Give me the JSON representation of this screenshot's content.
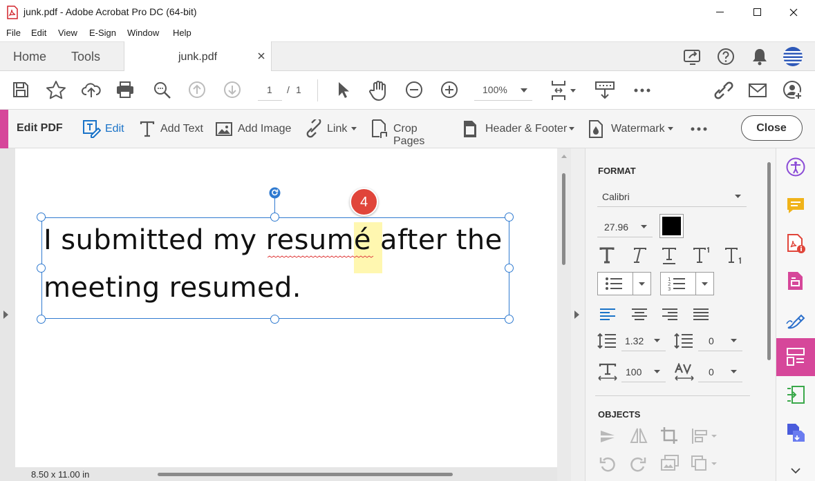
{
  "window": {
    "title": "junk.pdf - Adobe Acrobat Pro DC (64-bit)",
    "controls": [
      "minimize",
      "maximize",
      "close"
    ]
  },
  "menu": [
    "File",
    "Edit",
    "View",
    "E-Sign",
    "Window",
    "Help"
  ],
  "tabs": {
    "home": "Home",
    "tools": "Tools",
    "document": "junk.pdf"
  },
  "toolbar": {
    "page_current": "1",
    "page_separator": "/",
    "page_total": "1",
    "zoom": "100%"
  },
  "edit_bar": {
    "label": "Edit PDF",
    "tools": [
      "Edit",
      "Add Text",
      "Add Image",
      "Link",
      "Crop Pages",
      "Header & Footer",
      "Watermark"
    ],
    "close_label": "Close"
  },
  "document": {
    "line1": "I submitted my resumé after the",
    "line2": "meeting resumed.",
    "callout_badge": "4",
    "page_size": "8.50 x 11.00 in"
  },
  "format_panel": {
    "format_title": "FORMAT",
    "font_family": "Calibri",
    "font_size": "27.96",
    "font_color": "#000000",
    "line_spacing": "1.32",
    "paragraph_spacing": "0",
    "horizontal_scale": "100",
    "char_spacing": "0",
    "objects_title": "OBJECTS"
  },
  "colors": {
    "accent": "#d6479a",
    "selection": "#2f7ad0",
    "badge": "#e0453a",
    "highlight": "#fff7b0"
  }
}
